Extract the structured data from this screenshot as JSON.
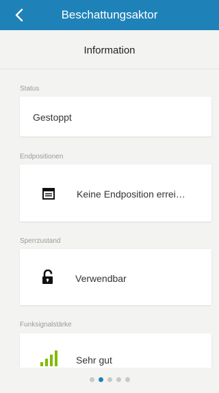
{
  "header": {
    "title": "Beschattungsaktor"
  },
  "subheader": {
    "title": "Information"
  },
  "sections": {
    "status": {
      "label": "Status",
      "value": "Gestoppt"
    },
    "endpositions": {
      "label": "Endpositionen",
      "value": "Keine Endposition errei…"
    },
    "lock": {
      "label": "Sperrzustand",
      "value": "Verwendbar"
    },
    "signal": {
      "label": "Funksignalstärke",
      "value": "Sehr gut"
    }
  },
  "colors": {
    "accent": "#1e82b8",
    "signal": "#7fba00"
  },
  "pager": {
    "count": 5,
    "active_index": 1
  }
}
